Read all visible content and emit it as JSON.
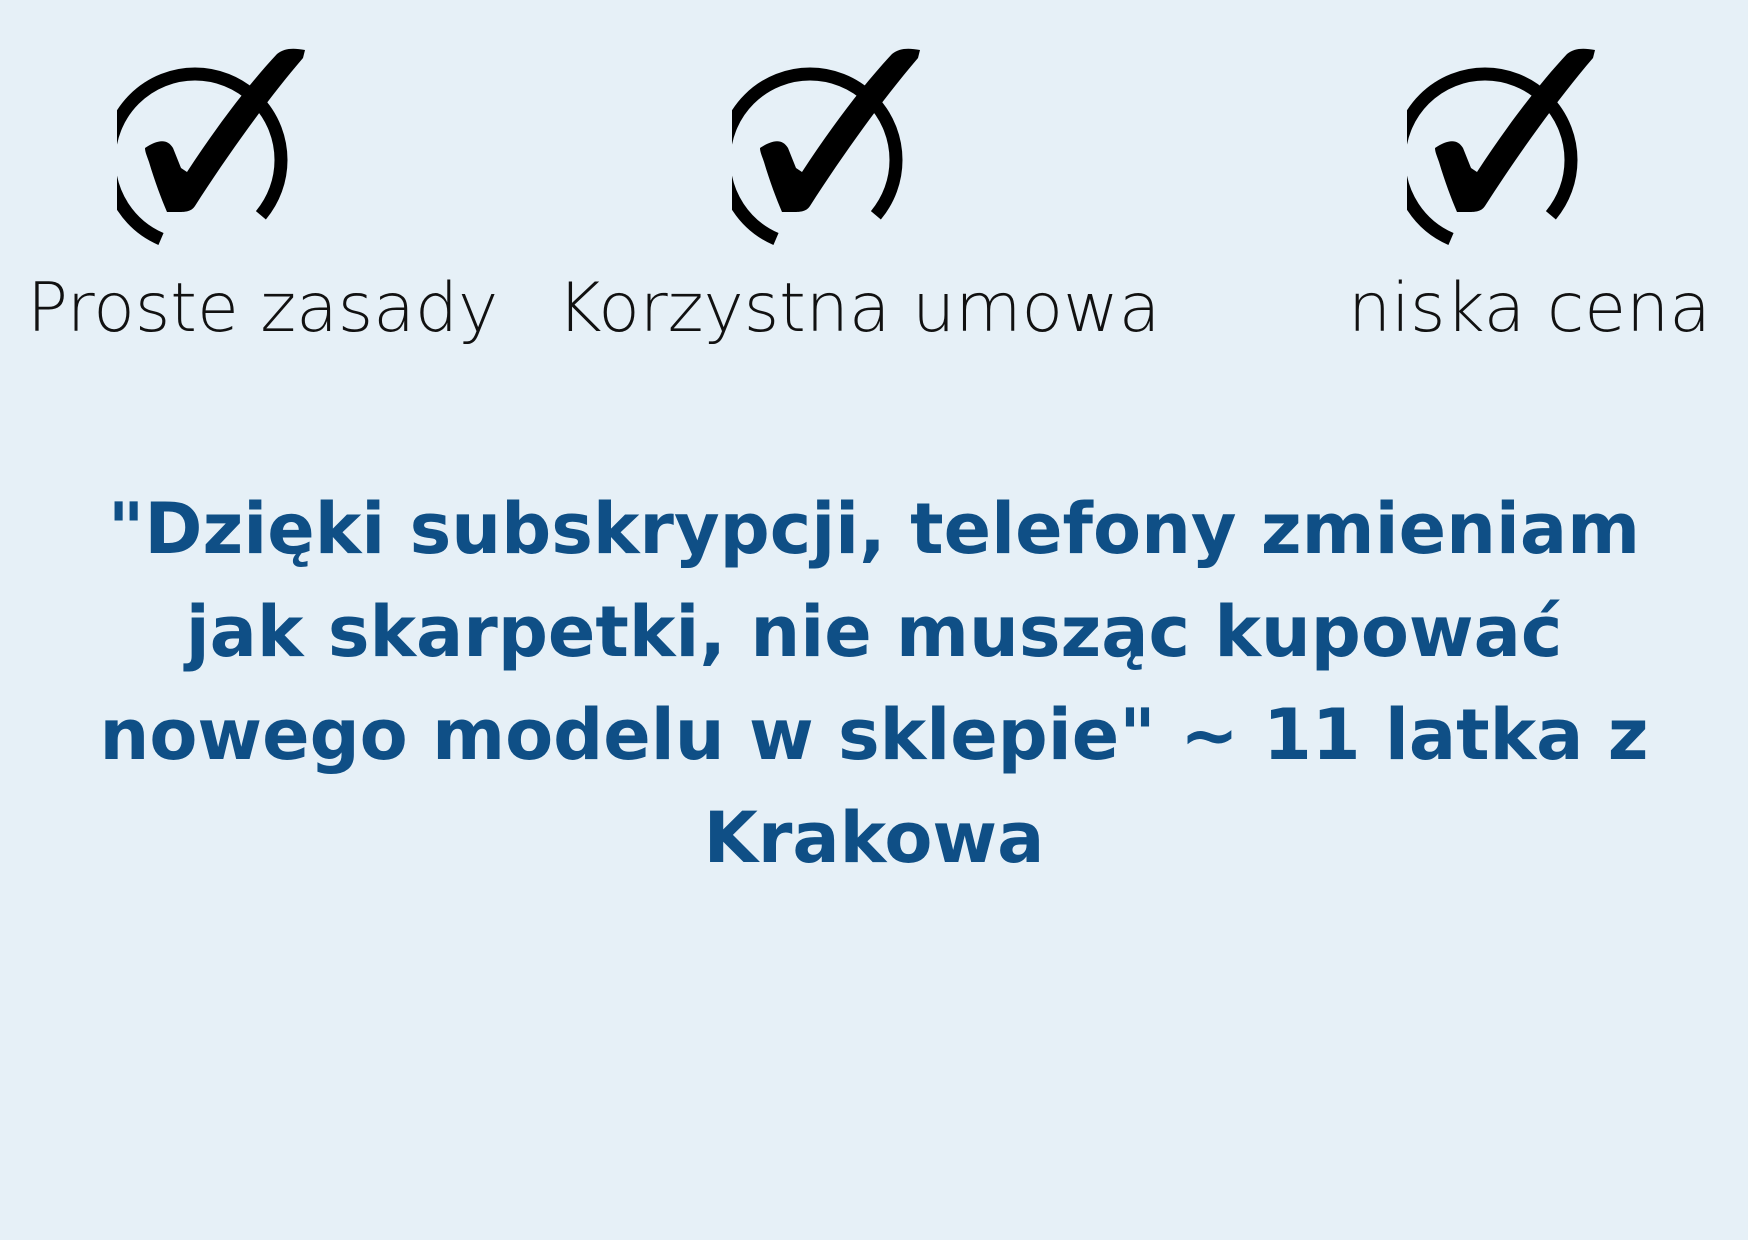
{
  "features": [
    {
      "label": "Proste zasady",
      "icon": "check-circle-icon"
    },
    {
      "label": "Korzystna umowa",
      "icon": "check-circle-icon"
    },
    {
      "label": "niska cena",
      "icon": "check-circle-icon"
    }
  ],
  "quote": {
    "text": "\"Dzięki subskrypcji, telefony zmieniam jak skarpetki, nie musząc kupować nowego modelu w sklepie\" ~ 11 latka z Krakowa"
  },
  "colors": {
    "background": "#e6f0f7",
    "quote_text": "#0f4f86",
    "feature_text": "#111111",
    "icon": "#000000"
  }
}
